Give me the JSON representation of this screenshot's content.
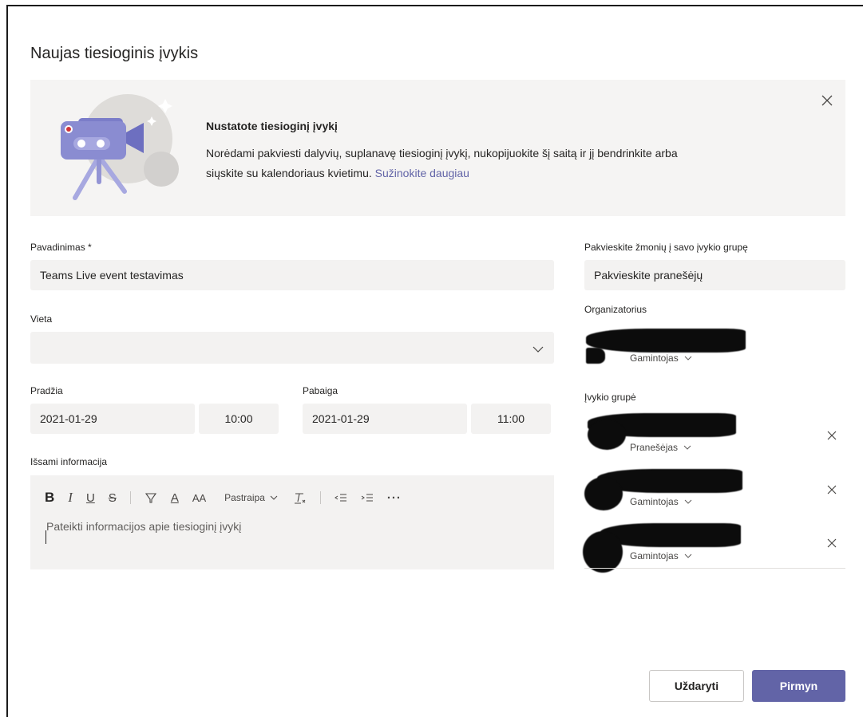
{
  "dialog": {
    "title": "Naujas tiesioginis įvykis"
  },
  "banner": {
    "heading": "Nustatote tiesioginį įvykį",
    "body_line1": "Norėdami pakviesti dalyvių, suplanavę tiesioginį įvykį, nukopijuokite šį saitą ir jį bendrinkite arba",
    "body_line2": "siųskite su kalendoriaus kvietimu.",
    "link": "Sužinokite daugiau",
    "close_icon": "close-icon"
  },
  "form": {
    "title_label": "Pavadinimas *",
    "title_value": "Teams Live event testavimas",
    "location_label": "Vieta",
    "location_value": "",
    "start_label": "Pradžia",
    "start_date": "2021-01-29",
    "start_time": "10:00",
    "end_label": "Pabaiga",
    "end_date": "2021-01-29",
    "end_time": "11:00",
    "details_label": "Išsami informacija",
    "details_placeholder": "Pateikti informacijos apie tiesioginį įvykį"
  },
  "toolbar": {
    "bold": "B",
    "italic": "I",
    "underline": "U",
    "strike": "S",
    "font_color": "A",
    "font_size": "AA",
    "paragraph": "Pastraipa",
    "more": "···"
  },
  "invite": {
    "label": "Pakvieskite žmonių į savo įvykio grupę",
    "placeholder": "Pakvieskite pranešėjų",
    "organizer_label": "Organizatorius",
    "organizer_role": "Gamintojas",
    "group_label": "Įvykio grupė",
    "members": [
      {
        "role": "Pranešėjas"
      },
      {
        "role": "Gamintojas"
      },
      {
        "role": "Gamintojas"
      }
    ]
  },
  "footer": {
    "close_label": "Uždaryti",
    "next_label": "Pirmyn"
  },
  "colors": {
    "accent": "#6264a7",
    "field_bg": "#f3f2f1",
    "banner_bg": "#f5f4f3"
  }
}
